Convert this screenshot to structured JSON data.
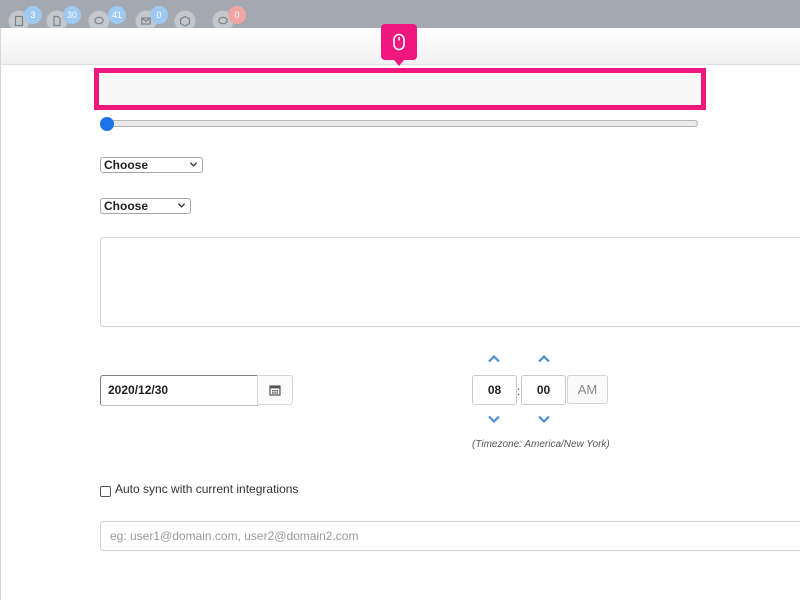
{
  "toolbar": {
    "items": [
      {
        "icon": "document-icon",
        "badge": "3",
        "badge_color": "#9ec9f0"
      },
      {
        "icon": "file-icon",
        "badge": "30",
        "badge_color": "#9ec9f0"
      },
      {
        "icon": "chat-icon",
        "badge": "41",
        "badge_color": "#9ec9f0"
      },
      {
        "icon": "mail-icon",
        "badge": "0",
        "badge_color": "#9ec9f0"
      },
      {
        "icon": "box-icon",
        "badge": "",
        "badge_color": "#9ec9f0"
      },
      {
        "icon": "comment-icon",
        "badge": "0",
        "badge_color": "#f3a5a5"
      }
    ]
  },
  "marker": {
    "icon": "mouse-icon",
    "color": "#f0177f"
  },
  "form": {
    "highlighted_input": {
      "value": "",
      "placeholder": ""
    },
    "slider": {
      "value_fraction": 0.0,
      "accent": "#1a73e8"
    },
    "select1": {
      "selected": "Choose"
    },
    "select2": {
      "selected": "Choose"
    },
    "textarea": {
      "value": ""
    },
    "date": {
      "value": "2020/12/30",
      "button_icon": "calendar-icon"
    },
    "time": {
      "hour": "08",
      "minute": "00",
      "separator": ":",
      "period": "AM",
      "arrow_color": "#4a8fd1"
    },
    "timezone_note": "(Timezone: America/New  York)",
    "auto_sync": {
      "checked": false,
      "label": "Auto sync with current integrations"
    },
    "emails": {
      "value": "",
      "placeholder": "eg: user1@domain.com, user2@domain2.com"
    }
  }
}
